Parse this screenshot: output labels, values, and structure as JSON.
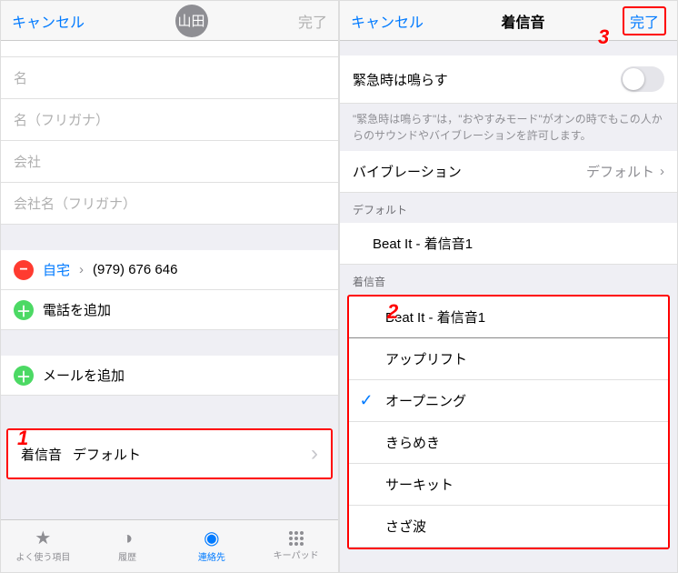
{
  "left": {
    "nav": {
      "cancel": "キャンセル",
      "avatar": "山田",
      "done": "完了"
    },
    "fields": {
      "sei_p": "",
      "mei": "名",
      "mei_furigana": "名（フリガナ）",
      "company": "会社",
      "company_furigana": "会社名（フリガナ）"
    },
    "phone": {
      "type": "自宅",
      "number": "(979) 676 646",
      "add": "電話を追加"
    },
    "mail": {
      "add": "メールを追加"
    },
    "ringtone": {
      "label": "着信音",
      "value": "デフォルト"
    },
    "tabs": {
      "favorites": "よく使う項目",
      "recents": "履歴",
      "contacts": "連絡先",
      "keypad": "キーパッド"
    },
    "annotation1": "1"
  },
  "right": {
    "nav": {
      "cancel": "キャンセル",
      "title": "着信音",
      "done": "完了"
    },
    "emergency": "緊急時は鳴らす",
    "help": "\"緊急時は鳴らす\"は，\"おやすみモード\"がオンの時でもこの人からのサウンドやバイブレーションを許可します。",
    "vibration": {
      "label": "バイブレーション",
      "value": "デフォルト"
    },
    "default_h": "デフォルト",
    "default_tone": "Beat It - 着信音1",
    "ringtone_h": "着信音",
    "tones": [
      "Beat It - 着信音1",
      "アップリフト",
      "オープニング",
      "きらめき",
      "サーキット",
      "さざ波"
    ],
    "selected_index": 2,
    "annotation2": "2",
    "annotation3": "3"
  }
}
